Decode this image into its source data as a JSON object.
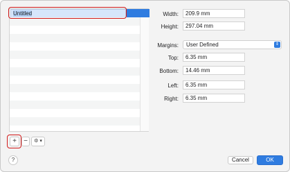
{
  "list": {
    "editing_name": "Untitled"
  },
  "controls": {
    "add_label": "+",
    "remove_label": "−",
    "actions_label": "⚙ ▾"
  },
  "form": {
    "width_label": "Width:",
    "width_value": "209.9 mm",
    "height_label": "Height:",
    "height_value": "297.04 mm",
    "margins_label": "Margins:",
    "margins_value": "User Defined",
    "top_label": "Top:",
    "top_value": "6.35 mm",
    "bottom_label": "Bottom:",
    "bottom_value": "14.46 mm",
    "left_label": "Left:",
    "left_value": "6.35 mm",
    "right_label": "Right:",
    "right_value": "6.35 mm"
  },
  "footer": {
    "help_label": "?",
    "cancel_label": "Cancel",
    "ok_label": "OK"
  },
  "colors": {
    "accent": "#2f7ce0",
    "highlight_ring": "#d11a1a"
  }
}
